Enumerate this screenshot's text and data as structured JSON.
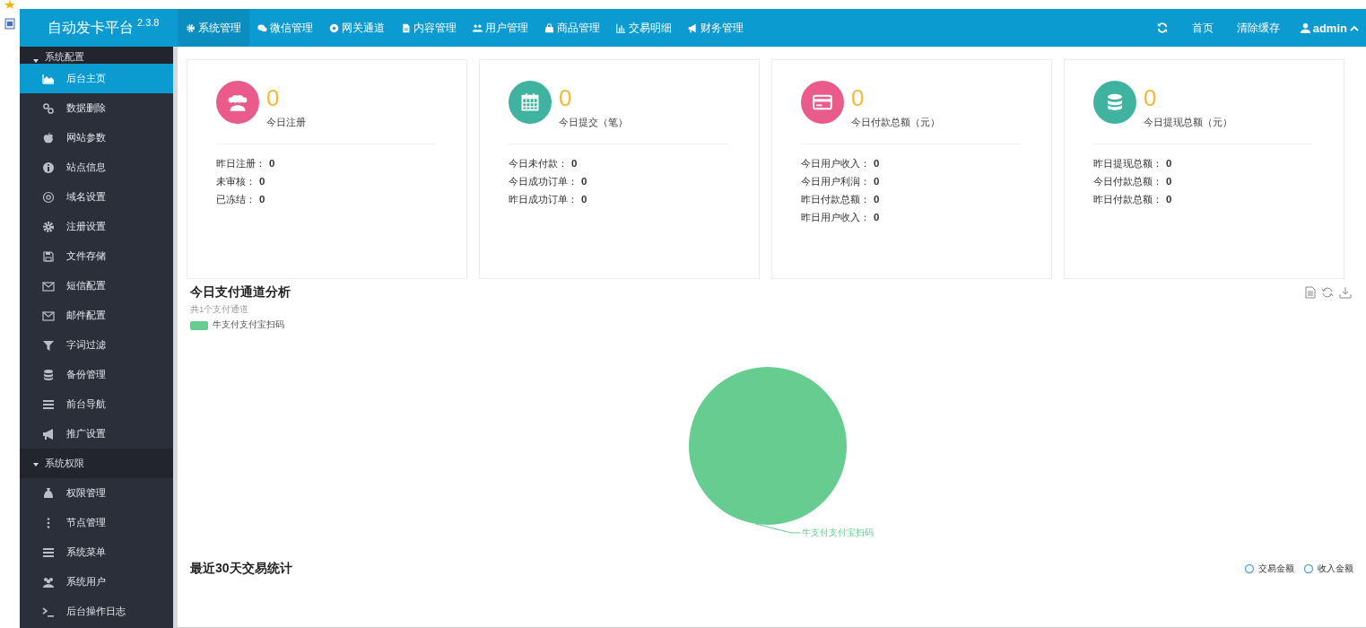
{
  "header": {
    "logo": "自动发卡平台",
    "version": "2.3.8",
    "nav": [
      {
        "label": "系统管理",
        "selected": true
      },
      {
        "label": "微信管理",
        "selected": false
      },
      {
        "label": "网关通道",
        "selected": false
      },
      {
        "label": "内容管理",
        "selected": false
      },
      {
        "label": "用户管理",
        "selected": false
      },
      {
        "label": "商品管理",
        "selected": false
      },
      {
        "label": "交易明细",
        "selected": false
      },
      {
        "label": "财务管理",
        "selected": false
      }
    ],
    "right": [
      {
        "label": "首页"
      },
      {
        "label": "清除缓存"
      }
    ],
    "user": "admin"
  },
  "sidebar": {
    "groups": [
      {
        "title": "系统配置",
        "expanded": true,
        "items": [
          {
            "label": "后台主页",
            "selected": true
          },
          {
            "label": "数据删除",
            "selected": false
          },
          {
            "label": "网站参数",
            "selected": false
          },
          {
            "label": "站点信息",
            "selected": false
          },
          {
            "label": "域名设置",
            "selected": false
          },
          {
            "label": "注册设置",
            "selected": false
          },
          {
            "label": "文件存储",
            "selected": false
          },
          {
            "label": "短信配置",
            "selected": false
          },
          {
            "label": "邮件配置",
            "selected": false
          },
          {
            "label": "字词过滤",
            "selected": false
          },
          {
            "label": "备份管理",
            "selected": false
          },
          {
            "label": "前台导航",
            "selected": false
          },
          {
            "label": "推广设置",
            "selected": false
          }
        ]
      },
      {
        "title": "系统权限",
        "expanded": true,
        "items": [
          {
            "label": "权限管理",
            "selected": false
          },
          {
            "label": "节点管理",
            "selected": false
          },
          {
            "label": "系统菜单",
            "selected": false
          },
          {
            "label": "系统用户",
            "selected": false
          },
          {
            "label": "后台操作日志",
            "selected": false
          }
        ]
      }
    ]
  },
  "cards": [
    {
      "value": "0",
      "label": "今日注册",
      "color": "#e95b8b",
      "rows": [
        {
          "name": "昨日注册：",
          "value": "0"
        },
        {
          "name": "未审核：",
          "value": "0"
        },
        {
          "name": "已冻结：",
          "value": "0"
        }
      ]
    },
    {
      "value": "0",
      "label": "今日提交（笔）",
      "color": "#3fb3a0",
      "rows": [
        {
          "name": "今日未付款：",
          "value": "0"
        },
        {
          "name": "今日成功订单：",
          "value": "0"
        },
        {
          "name": "昨日成功订单：",
          "value": "0"
        }
      ]
    },
    {
      "value": "0",
      "label": "今日付款总额（元）",
      "color": "#e95b8b",
      "rows": [
        {
          "name": "今日用户收入：",
          "value": "0"
        },
        {
          "name": "今日用户利润：",
          "value": "0"
        },
        {
          "name": "昨日付款总额：",
          "value": "0"
        },
        {
          "name": "昨日用户收入：",
          "value": "0"
        }
      ]
    },
    {
      "value": "0",
      "label": "今日提现总额（元）",
      "color": "#3fb3a0",
      "rows": [
        {
          "name": "昨日提现总额：",
          "value": "0"
        },
        {
          "name": "今日付款总额：",
          "value": "0"
        },
        {
          "name": "昨日付款总额：",
          "value": "0"
        }
      ]
    }
  ],
  "pay_analysis": {
    "title": "今日支付通道分析",
    "subtitle": "共1个支付通道",
    "legend": [
      {
        "name": "牛支付支付宝扫码",
        "color": "#66cc8f"
      }
    ],
    "pie_label": "牛支付支付宝扫码"
  },
  "trade_stats": {
    "title": "最近30天交易统计",
    "legend": [
      {
        "name": "交易金额"
      },
      {
        "name": "收入金额"
      }
    ]
  }
}
